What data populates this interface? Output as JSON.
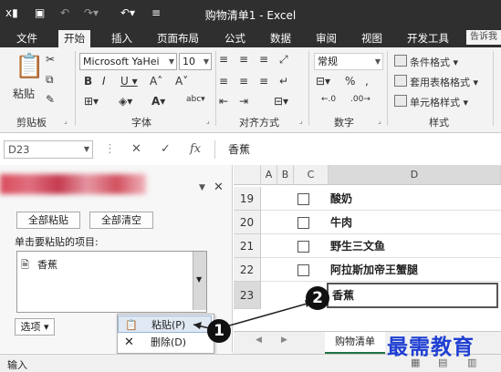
{
  "window": {
    "title": "购物清单1 - Excel"
  },
  "ribbon_tabs": [
    "文件",
    "开始",
    "插入",
    "页面布局",
    "公式",
    "数据",
    "审阅",
    "视图",
    "开发工具"
  ],
  "tell_me": "告诉我",
  "clipboard_group": {
    "paste": "粘贴",
    "label": "剪贴板"
  },
  "font_group": {
    "font_name": "Microsoft YaHei",
    "font_size": "10",
    "label": "字体"
  },
  "alignment_group": {
    "label": "对齐方式"
  },
  "number_group": {
    "format": "常规",
    "label": "数字"
  },
  "styles_group": {
    "conditional": "条件格式",
    "table_format": "套用表格格式",
    "cell_styles": "单元格样式",
    "label": "样式"
  },
  "formula_bar": {
    "name_box": "D23",
    "fx": "fx",
    "content": "香蕉"
  },
  "clipboard_pane": {
    "paste_all": "全部粘贴",
    "clear_all": "全部清空",
    "instruction": "单击要粘贴的项目:",
    "items": [
      "香蕉"
    ],
    "options": "选项"
  },
  "context_menu": {
    "paste": "粘贴(P)",
    "delete": "删除(D)"
  },
  "grid": {
    "columns": [
      "A",
      "B",
      "C",
      "D"
    ],
    "rows": [
      {
        "num": "19",
        "checkbox": true,
        "text": "酸奶"
      },
      {
        "num": "20",
        "checkbox": true,
        "text": "牛肉"
      },
      {
        "num": "21",
        "checkbox": true,
        "text": "野生三文鱼"
      },
      {
        "num": "22",
        "checkbox": true,
        "text": "阿拉斯加帝王蟹腿"
      },
      {
        "num": "23",
        "checkbox": false,
        "text": "香蕉"
      }
    ]
  },
  "sheet_tab": "购物清单",
  "status": "输入",
  "markers": [
    "1",
    "2"
  ],
  "watermark": "最需教育"
}
